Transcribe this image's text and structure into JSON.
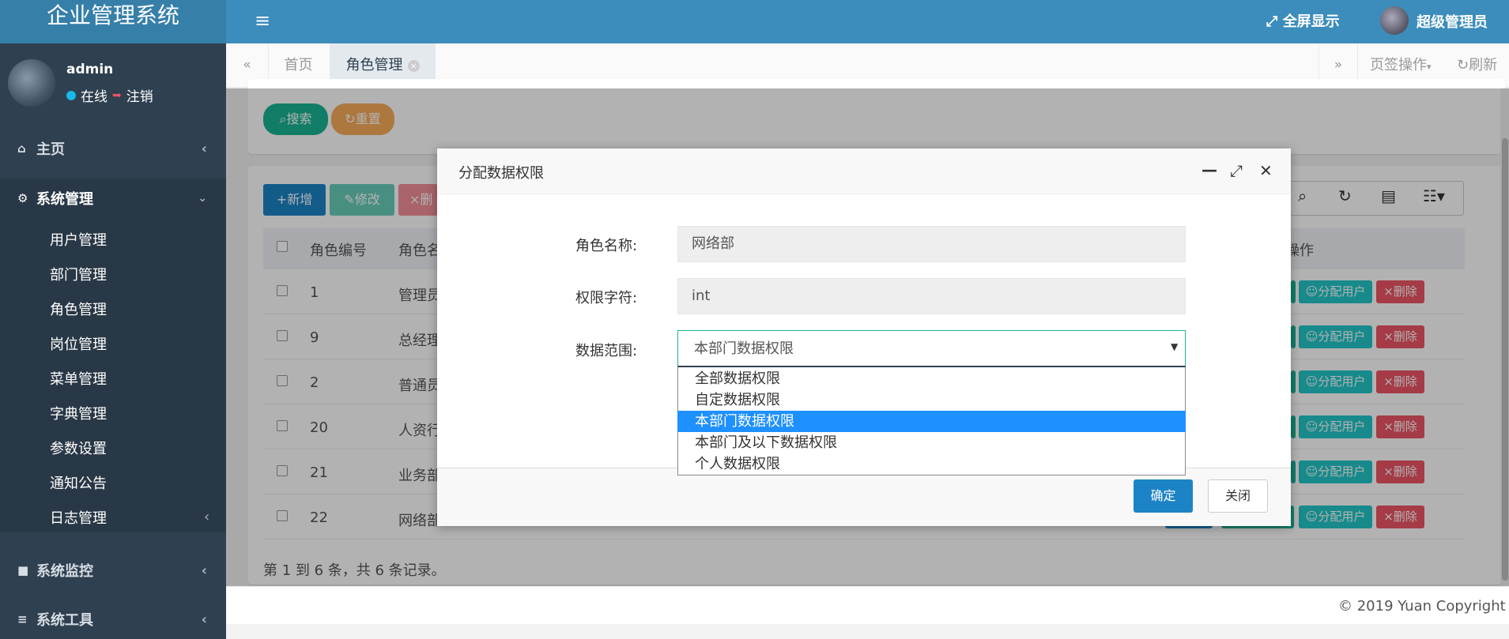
{
  "app": {
    "title": "企业管理系统"
  },
  "header": {
    "fullscreen": "全屏显示",
    "user": "超级管理员",
    "menu_icon": "bars-icon"
  },
  "profile": {
    "name": "admin",
    "online": "在线",
    "logout": "注销"
  },
  "sidebar": {
    "home": "主页",
    "system": "系统管理",
    "system_items": [
      "用户管理",
      "部门管理",
      "角色管理",
      "岗位管理",
      "菜单管理",
      "字典管理",
      "参数设置",
      "通知公告",
      "日志管理"
    ],
    "monitor": "系统监控",
    "tools": "系统工具"
  },
  "tabs": {
    "home": "首页",
    "role": "角色管理",
    "ops": "页签操作",
    "refresh": "刷新"
  },
  "search": {
    "search": "搜索",
    "reset": "重置"
  },
  "toolbar": {
    "add": "新增",
    "edit": "修改",
    "delete": "删"
  },
  "table": {
    "headers": [
      "角色编号",
      "角色名",
      "操作"
    ],
    "rows": [
      {
        "id": "1",
        "name": "管理员"
      },
      {
        "id": "9",
        "name": "总经理"
      },
      {
        "id": "2",
        "name": "普通员"
      },
      {
        "id": "20",
        "name": "人资行"
      },
      {
        "id": "21",
        "name": "业务部"
      },
      {
        "id": "22",
        "name": "网络部"
      }
    ],
    "assign_label": "分配用户",
    "delete_label": "删除",
    "summary": "第 1 到 6 条，共 6 条记录。"
  },
  "modal": {
    "title": "分配数据权限",
    "role_name_label": "角色名称:",
    "role_name_value": "网络部",
    "perm_label": "权限字符:",
    "perm_value": "int",
    "scope_label": "数据范围:",
    "scope_selected": "本部门数据权限",
    "scope_options": [
      "全部数据权限",
      "自定数据权限",
      "本部门数据权限",
      "本部门及以下数据权限",
      "个人数据权限"
    ],
    "ok": "确定",
    "close": "关闭"
  },
  "footer": {
    "copyright": "© 2019 Yuan Copyright"
  },
  "colors": {
    "topbar": "#3c8dbc",
    "sidebar": "#2f4050",
    "primary": "#1c84c6",
    "success": "#1ab394",
    "danger": "#ed5565",
    "warning": "#f8ac59",
    "info": "#23c6c8"
  }
}
